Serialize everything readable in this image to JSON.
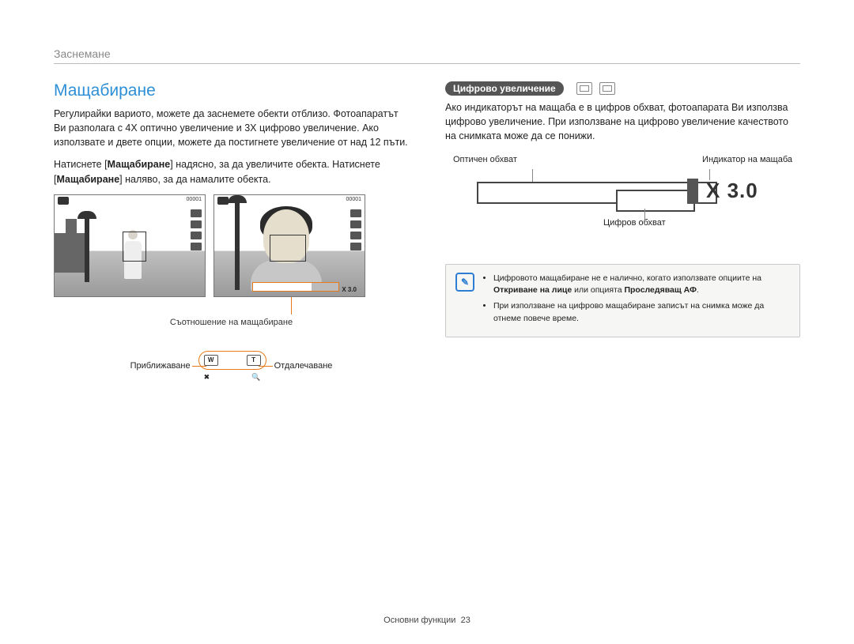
{
  "chapter": "Заснемане",
  "title": "Мащабиране",
  "para1": "Регулирайки вариото, можете да заснемете обекти отблизо. Фотоапаратът Ви разполага с 4X оптично увеличение и 3X цифрово увеличение. Ако използвате и двете опции, можете да постигнете увеличение от над 12 пъти.",
  "para2a": "Натиснете [",
  "para2b": "] надясно, за да увеличите обекта. Натиснете [",
  "para2c": "] наляво, за да намалите обекта.",
  "zoom_word": "Мащабиране",
  "shot_counter": "00001",
  "zoom_ratio_overlay": "X 3.0",
  "caption_zoom_ratio": "Съотношение на мащабиране",
  "zoom_in": "Приближаване",
  "zoom_out": "Отдалечаване",
  "rocker_w": "W",
  "rocker_t": "T",
  "rocker_sub_left": "✖",
  "rocker_sub_right": "🔍",
  "subheading": "Цифрово увеличение",
  "right_para": "Ако индикаторът на мащаба е в цифров обхват, фотоапарата Ви използва цифрово увеличение. При използване на цифрово увеличение качеството на снимката може да се понижи.",
  "label_optical": "Оптичен обхват",
  "label_indicator": "Индикатор на мащаба",
  "label_digital": "Цифров обхват",
  "zoom_value": "X 3.0",
  "note1a": "Цифровото мащабиране не е налично, когато използвате опциите на ",
  "note1b": "Откриване на лице",
  "note1c": " или опцията ",
  "note1d": "Проследяващ АФ",
  "note1e": ".",
  "note2": "При използване на цифрово мащабиране записът на снимка може да отнеме повече време.",
  "footer_label": "Основни функции",
  "page_number": "23"
}
